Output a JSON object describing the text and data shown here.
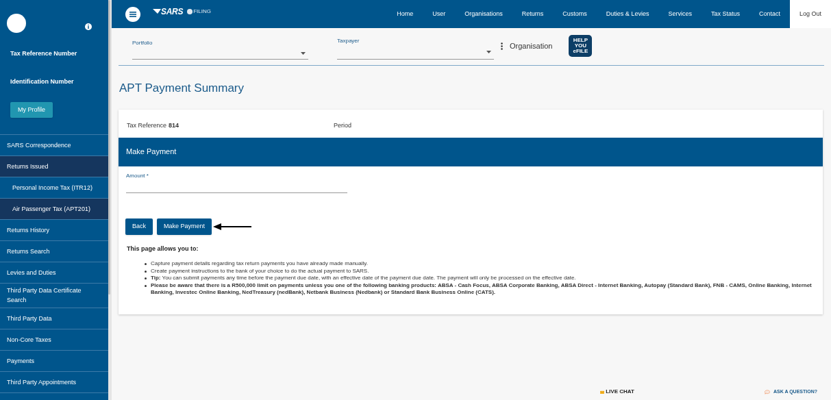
{
  "sidebar": {
    "profile_labels": [
      "Tax Reference Number",
      "Identification Number"
    ],
    "profile_button": "My Profile",
    "items": [
      {
        "label": "SARS Correspondence",
        "selected": false
      },
      {
        "label": "Returns Issued",
        "selected": true,
        "children": [
          {
            "label": "Personal Income Tax (ITR12)",
            "selected": false
          },
          {
            "label": "Air Passenger Tax (APT201)",
            "selected": true
          }
        ]
      },
      {
        "label": "Returns History",
        "selected": false
      },
      {
        "label": "Returns Search",
        "selected": false
      },
      {
        "label": "Levies and Duties",
        "selected": false
      },
      {
        "label": "Third Party Data Certificate Search",
        "selected": false
      },
      {
        "label": "Third Party Data",
        "selected": false
      },
      {
        "label": "Non-Core Taxes",
        "selected": false
      },
      {
        "label": "Payments",
        "selected": false
      },
      {
        "label": "Third Party Appointments",
        "selected": false
      }
    ]
  },
  "header": {
    "brand": "SARS",
    "sub_brand": "FILING",
    "nav": [
      {
        "label": "Home",
        "selected": false
      },
      {
        "label": "User",
        "selected": false
      },
      {
        "label": "Organisations",
        "selected": false
      },
      {
        "label": "Returns",
        "selected": false
      },
      {
        "label": "Customs",
        "selected": false
      },
      {
        "label": "Duties & Levies",
        "selected": false
      },
      {
        "label": "Services",
        "selected": false
      },
      {
        "label": "Tax Status",
        "selected": false
      },
      {
        "label": "Contact",
        "selected": false
      },
      {
        "label": "Log Out",
        "selected": true
      }
    ]
  },
  "filters": {
    "portfolio_label": "Portfolio",
    "taxpayer_label": "Taxpayer",
    "context": "Organisation",
    "help_badge": [
      "HELP",
      "YOU",
      "eFILE"
    ]
  },
  "page_title": "APT Payment Summary",
  "summary": {
    "tax_reference_label": "Tax Reference",
    "tax_reference_value": "814",
    "period_label": "Period"
  },
  "panel": {
    "title": "Make Payment",
    "amount_label": "Amount *"
  },
  "buttons": [
    "Back",
    "Make Payment"
  ],
  "info": {
    "heading": "This page allows you to:",
    "bullets": [
      "Capture payment details regarding tax return payments you have already made manually.",
      "Create payment instructions to the bank of your choice to do the actual payment to SARS.",
      "**Tip:** You can submit payments any time before the payment due date, with an effective date of the payment due date. The payment will only be processed on the effective date.",
      "**Please be aware that there is a R500,000 limit on payments unless you one of the following banking products: ABSA - Cash Focus, ABSA Corporate Banking, ABSA Direct - Internet Banking, Autopay (Standard Bank), FNB - CAMS, Online Banking, Internet Banking, Investec Online Banking, NedTreasury (nedBank), Netbank Business (Nedbank) or Standard Bank Business Online (CATS).**"
    ]
  },
  "footer": {
    "live_chat": "LIVE CHAT",
    "ask": "ASK A QUESTION?"
  }
}
